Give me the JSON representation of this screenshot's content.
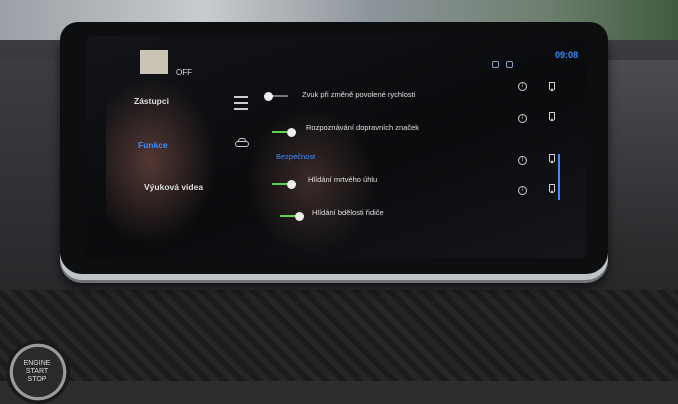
{
  "screen": {
    "off_label": "OFF",
    "clock": "09:08"
  },
  "sidebar": {
    "items": [
      {
        "label": "Zástupci",
        "active": false
      },
      {
        "label": "Funkce",
        "active": true
      },
      {
        "label": "Výuková videa",
        "active": false
      }
    ]
  },
  "settings": {
    "rows": [
      {
        "label": "Zvuk při změně povolené rychlosti",
        "on": false
      },
      {
        "label": "Rozpoznávání dopravních značek",
        "on": true
      },
      {
        "label": "Hlídání mrtvého úhlu",
        "on": true
      },
      {
        "label": "Hlídání bdělosti řidiče",
        "on": true
      }
    ],
    "section_label": "Bezpečnost"
  },
  "icons": [
    "menu-icon",
    "car-icon",
    "info-icon",
    "bookmark-icon"
  ],
  "console": {
    "start_button_lines": [
      "ENGINE",
      "START",
      "STOP"
    ]
  },
  "colors": {
    "accent": "#3d8bff",
    "toggle_on": "#5fd14a"
  }
}
